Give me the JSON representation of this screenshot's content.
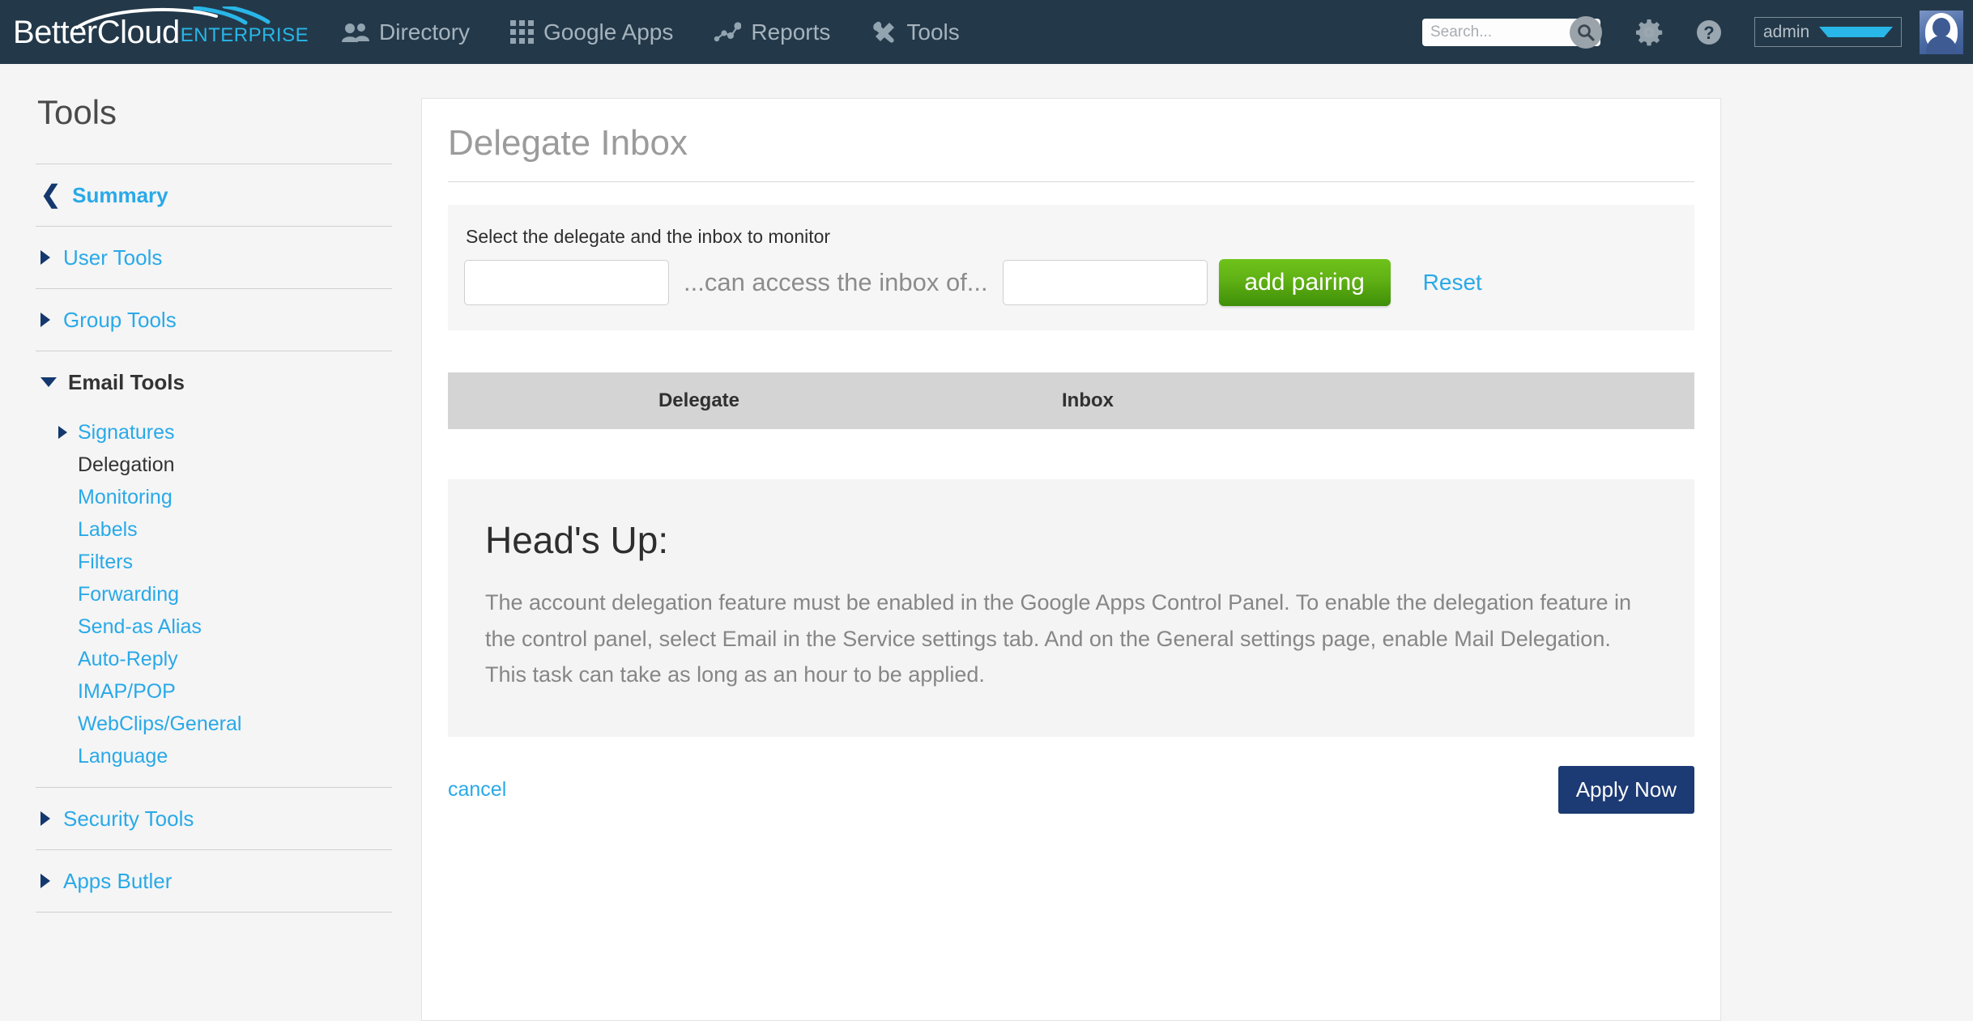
{
  "topnav": {
    "logo": {
      "name": "BetterCloud",
      "edition": "ENTERPRISE"
    },
    "items": [
      {
        "label": "Directory",
        "icon": "people-icon"
      },
      {
        "label": "Google Apps",
        "icon": "grid-icon"
      },
      {
        "label": "Reports",
        "icon": "chart-icon"
      },
      {
        "label": "Tools",
        "icon": "tools-icon"
      }
    ],
    "search": {
      "placeholder": "Search...",
      "value": ""
    },
    "settings_icon": "gear-icon",
    "help_icon": "help-icon",
    "user": "admin",
    "avatar_icon": "user-avatar"
  },
  "sidebar": {
    "title": "Tools",
    "summary": "Summary",
    "groups": [
      {
        "label": "User Tools",
        "state": "collapsed"
      },
      {
        "label": "Group Tools",
        "state": "collapsed"
      },
      {
        "label": "Email Tools",
        "state": "expanded"
      }
    ],
    "email_tools_children": [
      {
        "label": "Signatures",
        "has_arrow": true,
        "current": false
      },
      {
        "label": "Delegation",
        "has_arrow": false,
        "current": true
      },
      {
        "label": "Monitoring",
        "has_arrow": false,
        "current": false
      },
      {
        "label": "Labels",
        "has_arrow": false,
        "current": false
      },
      {
        "label": "Filters",
        "has_arrow": false,
        "current": false
      },
      {
        "label": "Forwarding",
        "has_arrow": false,
        "current": false
      },
      {
        "label": "Send-as Alias",
        "has_arrow": false,
        "current": false
      },
      {
        "label": "Auto-Reply",
        "has_arrow": false,
        "current": false
      },
      {
        "label": "IMAP/POP",
        "has_arrow": false,
        "current": false
      },
      {
        "label": "WebClips/General",
        "has_arrow": false,
        "current": false
      },
      {
        "label": "Language",
        "has_arrow": false,
        "current": false
      }
    ],
    "bottom_groups": [
      {
        "label": "Security Tools",
        "state": "collapsed"
      },
      {
        "label": "Apps Butler",
        "state": "collapsed"
      }
    ]
  },
  "main": {
    "title": "Delegate Inbox",
    "form": {
      "instruction": "Select the delegate and the inbox to monitor",
      "delegate_value": "",
      "delegate_placeholder": "",
      "between_text": "...can access the inbox of...",
      "inbox_value": "",
      "inbox_placeholder": "",
      "add_button": "add pairing",
      "reset_link": "Reset"
    },
    "table": {
      "columns": [
        "Delegate",
        "Inbox"
      ],
      "rows": []
    },
    "notice": {
      "title": "Head's Up:",
      "body": "The account delegation feature must be enabled in the Google Apps Control Panel. To enable the delegation feature in the control panel, select Email in the Service settings tab. And on the General settings page, enable Mail Delegation. This task can take as long as an hour to be applied."
    },
    "footer": {
      "cancel": "cancel",
      "apply": "Apply Now"
    }
  },
  "colors": {
    "nav_bg": "#23394a",
    "accent_cyan": "#29a9e8",
    "brand_cyan": "#29b6e8",
    "navy": "#14386e",
    "green": "#61b215",
    "apply_navy": "#1c3a73",
    "table_header": "#d4d4d4"
  }
}
